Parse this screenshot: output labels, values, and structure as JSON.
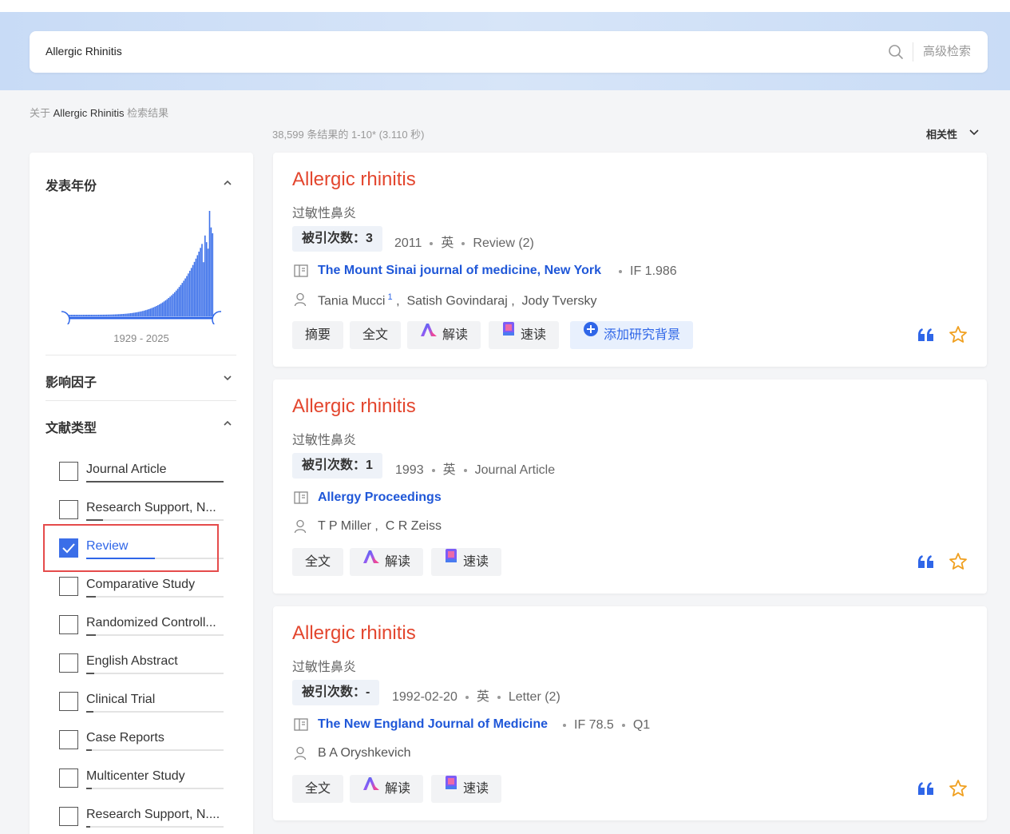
{
  "search": {
    "query": "Allergic Rhinitis",
    "advanced_label": "高级检索"
  },
  "summary": {
    "about_prefix": "关于",
    "about_query": "Allergic Rhinitis",
    "about_suffix": "检索结果",
    "count_text": "38,599 条结果的 1-10* (3.110 秒)",
    "sort_label": "相关性"
  },
  "sidebar": {
    "year_title": "发表年份",
    "year_range": "1929 - 2025",
    "impact_title": "影响因子",
    "type_title": "文献类型",
    "types": [
      {
        "label": "Journal Article",
        "checked": false,
        "level": 1.0
      },
      {
        "label": "Research Support, N...",
        "checked": false,
        "level": 0.12
      },
      {
        "label": "Review",
        "checked": true,
        "level": 0.5
      },
      {
        "label": "Comparative Study",
        "checked": false,
        "level": 0.07
      },
      {
        "label": "Randomized Controll...",
        "checked": false,
        "level": 0.07
      },
      {
        "label": "English Abstract",
        "checked": false,
        "level": 0.06
      },
      {
        "label": "Clinical Trial",
        "checked": false,
        "level": 0.05
      },
      {
        "label": "Case Reports",
        "checked": false,
        "level": 0.04
      },
      {
        "label": "Multicenter Study",
        "checked": false,
        "level": 0.04
      },
      {
        "label": "Research Support, N....",
        "checked": false,
        "level": 0.03
      }
    ]
  },
  "results": [
    {
      "title": "Allergic rhinitis",
      "subtitle": "过敏性鼻炎",
      "cite": "被引次数：3",
      "year": "2011",
      "lang": "英",
      "type": "Review (2)",
      "journal": "The Mount Sinai journal of medicine, New York",
      "if": "IF 1.986",
      "authors": [
        "Tania Mucci",
        "Satish Govindaraj",
        "Jody Tversky"
      ],
      "author_sup": "1",
      "buttons": [
        "摘要",
        "全文",
        "解读",
        "速读",
        "添加研究背景"
      ]
    },
    {
      "title": "Allergic rhinitis",
      "subtitle": "过敏性鼻炎",
      "cite": "被引次数：1",
      "year": "1993",
      "lang": "英",
      "type": "Journal Article",
      "journal": "Allergy Proceedings",
      "authors": [
        "T P Miller",
        "C R Zeiss"
      ],
      "buttons": [
        "全文",
        "解读",
        "速读"
      ]
    },
    {
      "title": "Allergic rhinitis",
      "subtitle": "过敏性鼻炎",
      "cite": "被引次数：-",
      "year": "1992-02-20",
      "lang": "英",
      "type": "Letter (2)",
      "journal": "The New England Journal of Medicine",
      "if": "IF 78.5",
      "quartile": "Q1",
      "authors": [
        "B A Oryshkevich"
      ],
      "buttons": [
        "全文",
        "解读",
        "速读"
      ]
    }
  ],
  "colors": {
    "accent": "#2f66e8",
    "title": "#e3462e",
    "highlight": "#e54b4b",
    "star": "#f0a020"
  }
}
